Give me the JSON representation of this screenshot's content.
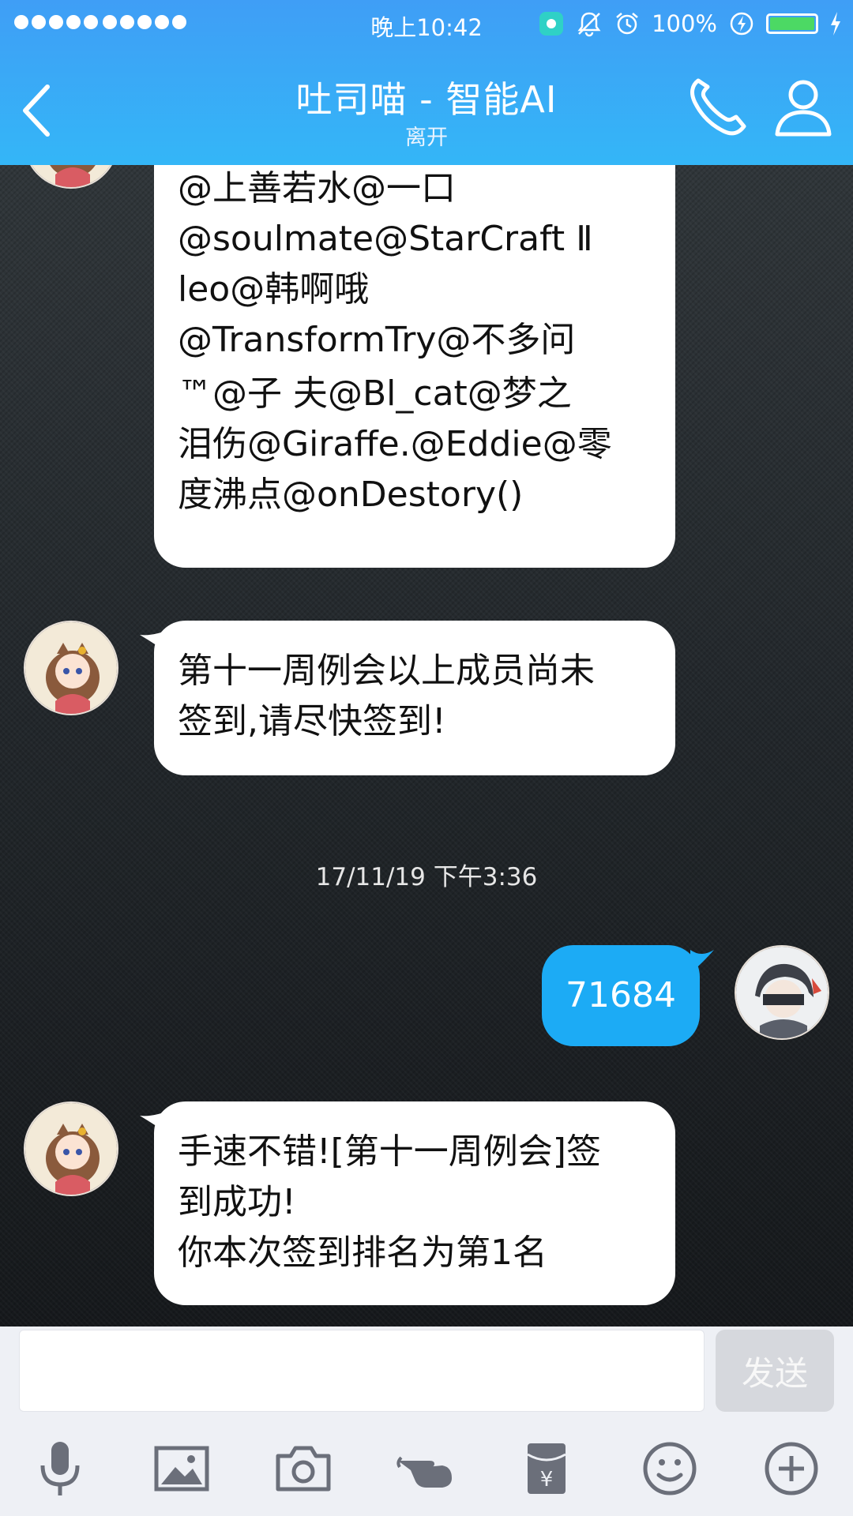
{
  "status_bar": {
    "time": "晚上10:42",
    "battery_pct": "100%",
    "battery_level": 1.0
  },
  "header": {
    "title": "吐司喵 - 智能AI",
    "subtitle": "离开"
  },
  "messages": [
    {
      "sender": "other",
      "lines": [
        "@上善若水@一口",
        "@soulmate@StarCraft Ⅱ",
        "leo@韩啊哦",
        "@TransformTry@不多问",
        "™@子 夫@Bl_cat@梦之",
        "泪伤@Giraffe.@Eddie@零",
        "度沸点@onDestory()"
      ]
    },
    {
      "sender": "other",
      "lines": [
        "第十一周例会以上成员尚未",
        "签到,请尽快签到!"
      ]
    },
    {
      "sender": "me",
      "text": "71684"
    },
    {
      "sender": "other",
      "lines": [
        "手速不错![第十一周例会]签",
        "到成功!",
        "你本次签到排名为第1名"
      ]
    }
  ],
  "timestamp": "17/11/19 下午3:36",
  "input": {
    "value": "",
    "send_label": "发送"
  },
  "toolbar": [
    "microphone-icon",
    "image-icon",
    "camera-icon",
    "poke-icon",
    "red-packet-icon",
    "emoji-icon",
    "plus-icon"
  ],
  "colors": {
    "header_top": "#3f9ef6",
    "header_bottom": "#34b6f7",
    "my_bubble": "#1cabf5",
    "battery_fill": "#4cd964"
  }
}
